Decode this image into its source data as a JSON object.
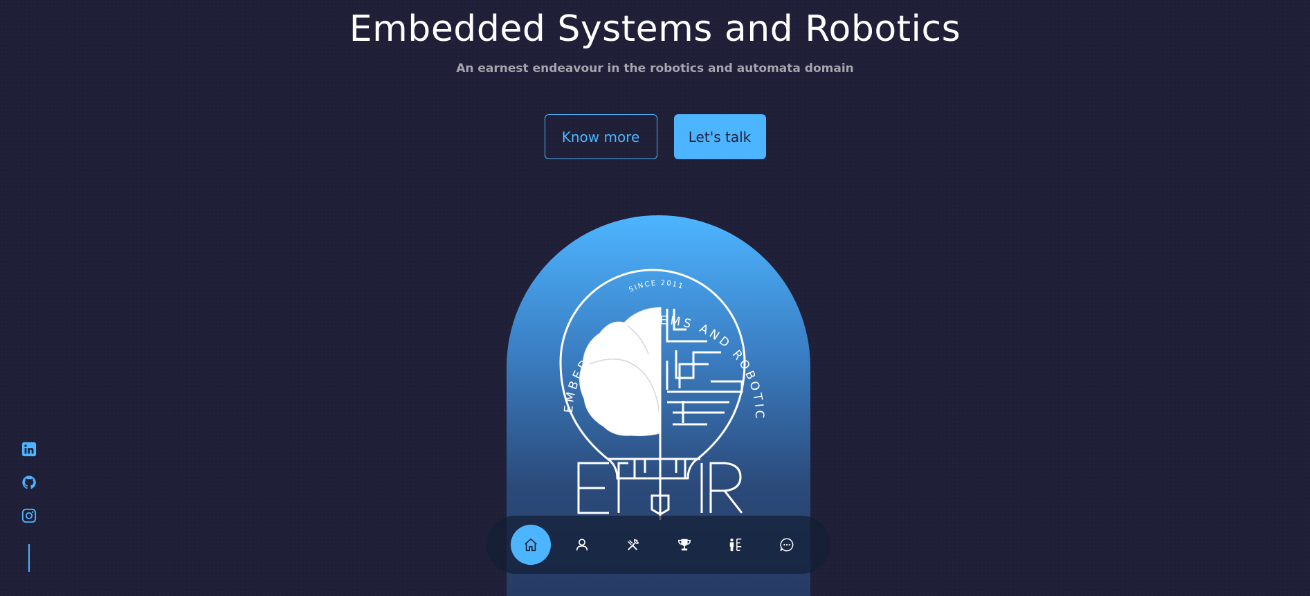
{
  "hero": {
    "title": "Embedded Systems and Robotics",
    "subtitle": "An earnest endeavour in the robotics and automata domain"
  },
  "buttons": {
    "know_more": "Know more",
    "lets_talk": "Let's talk"
  },
  "logo": {
    "ring_text": "EMBEDDED SYSTEMS AND ROBOTICS CLUB",
    "since_text": "SINCE 2011",
    "letters": "ESR"
  },
  "socials": [
    "linkedin-icon",
    "github-icon",
    "instagram-icon"
  ],
  "nav": {
    "items": [
      "home-icon",
      "user-icon",
      "tools-icon",
      "trophy-icon",
      "team-icon",
      "chat-icon"
    ],
    "active": "home-icon"
  },
  "colors": {
    "background": "#1f1f38",
    "accent": "#4db5ff",
    "text": "#ffffff"
  }
}
